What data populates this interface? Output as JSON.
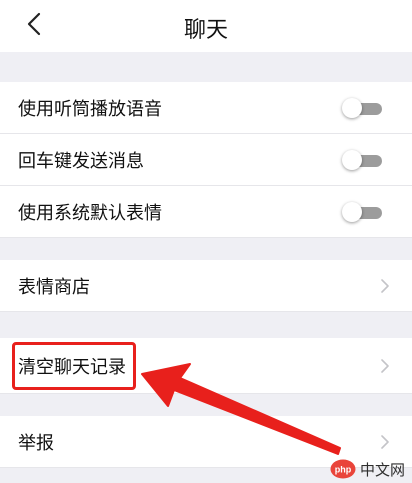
{
  "header": {
    "title": "聊天",
    "back_icon": "chevron-left-icon"
  },
  "toggles": [
    {
      "label": "使用听筒播放语音",
      "on": false
    },
    {
      "label": "回车键发送消息",
      "on": false
    },
    {
      "label": "使用系统默认表情",
      "on": false
    }
  ],
  "links": [
    {
      "label": "表情商店",
      "icon": "chevron-right-icon"
    },
    {
      "label": "清空聊天记录",
      "icon": "chevron-right-icon",
      "highlighted": true
    },
    {
      "label": "举报",
      "icon": "chevron-right-icon"
    }
  ],
  "annotation": {
    "color": "#e8201c",
    "shape": "arrow"
  },
  "colors": {
    "background": "#ffffff",
    "section_gap": "#efeff4",
    "toggle_off": "#9c9c9c",
    "highlight": "#e8201c"
  },
  "watermark": {
    "text": "中文网",
    "logo": "php-logo"
  }
}
